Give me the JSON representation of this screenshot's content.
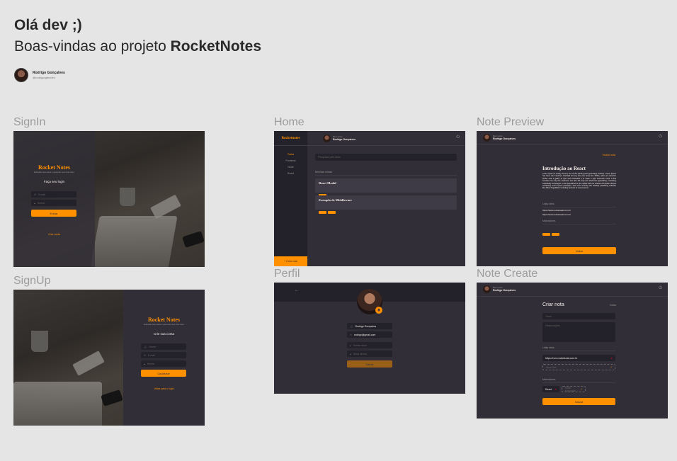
{
  "header": {
    "greeting": "Olá dev ;)",
    "welcome_prefix": "Boas-vindas ao projeto ",
    "project_name": "RocketNotes",
    "author_name": "Rodrigo Gonçalves",
    "author_handle": "@rodrigorgtecdev"
  },
  "frames": {
    "signin": {
      "label": "SignIn",
      "brand": "Rocket Notes",
      "subtitle": "Aplicação para salvar e gerenciar seus links úteis.",
      "heading": "Faça seu login",
      "email_placeholder": "E-mail",
      "password_placeholder": "Senha",
      "submit": "Entrar",
      "link": "Criar conta"
    },
    "signup": {
      "label": "SignUp",
      "brand": "Rocket Notes",
      "subtitle": "Aplicação para salvar e gerenciar seus links úteis.",
      "heading": "Crie sua conta",
      "name_placeholder": "Nome",
      "email_placeholder": "E-mail",
      "password_placeholder": "Senha",
      "submit": "Cadastrar",
      "link": "Voltar para o login"
    },
    "home": {
      "label": "Home",
      "brand": "Rocketnotes",
      "welcome": "Bem-vindo",
      "user": "Rodrigo Gonçalves",
      "menu": [
        "Todos",
        "Frontend",
        "Node",
        "React"
      ],
      "search_placeholder": "Pesquisar pelo título",
      "section": "Minhas notas",
      "notes": [
        {
          "title": "React Modal"
        },
        {
          "title": "Exemplo de Middleware"
        }
      ],
      "create": "+ Criar nota"
    },
    "preview": {
      "label": "Note Preview",
      "welcome": "Bem-vindo",
      "user": "Rodrigo Gonçalves",
      "delete_link": "Excluir nota",
      "title": "Introdução ao React",
      "body": "Lorem Ipsum is simply dummy text of the printing and typesetting industry. Lorem Ipsum has been the industry's standard dummy text ever since the 1500s, when an unknown printer took a galley of type and scrambled it to make a type specimen book. It has survived not only five centuries, but also the leap into electronic typesetting, remaining essentially unchanged. It was popularised in the 1960s with the release of Letraset sheets containing Lorem Ipsum passages, and more recently with desktop publishing software like Aldus PageMaker including versions of Lorem Ipsum.",
      "links_title": "Links úteis",
      "links": [
        "https://www.rocketseat.com.br",
        "https://www.rocketseat.com.br"
      ],
      "markers_title": "Marcadores",
      "back": "Voltar"
    },
    "profile": {
      "label": "Perfil",
      "name": "Rodrigo Gonçalves",
      "email": "rodrigo@gmail.com",
      "current_password": "Senha atual",
      "new_password": "Nova senha",
      "save": "Salvar"
    },
    "create": {
      "label": "Note Create",
      "welcome": "Bem-vindo",
      "user": "Rodrigo Gonçalves",
      "title": "Criar nota",
      "back_link": "Voltar",
      "title_placeholder": "Título",
      "notes_placeholder": "Observações",
      "links_title": "Links úteis",
      "link_value": "https://rum.rocketseat.com.br",
      "new_link": "Novo link",
      "markers_title": "Marcadores",
      "tag_value": "React",
      "new_tag": "Novo marcador",
      "save": "Salvar"
    }
  },
  "colors": {
    "background": "#312e38",
    "accent": "#ff9000",
    "page": "#e5e5e5"
  }
}
